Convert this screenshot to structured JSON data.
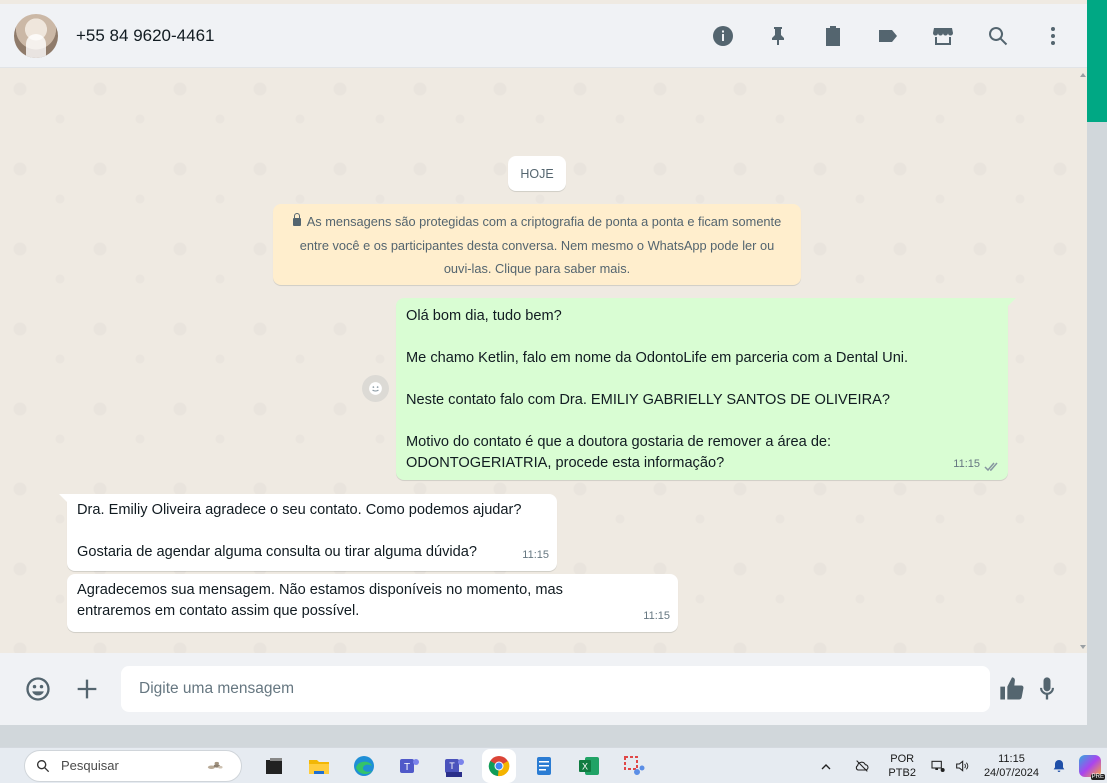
{
  "header": {
    "contact_name": "+55 84 9620-4461",
    "icons": [
      "info-icon",
      "pin-icon",
      "clipboard-icon",
      "label-icon",
      "store-icon",
      "search-icon",
      "more-vertical-icon"
    ]
  },
  "chat": {
    "date_chip": "HOJE",
    "encryption_notice": "As mensagens são protegidas com a criptografia de ponta a ponta e ficam somente entre você e os participantes desta conversa. Nem mesmo o WhatsApp pode ler ou ouvi-las. Clique para saber mais.",
    "messages": [
      {
        "direction": "outgoing",
        "text": "Olá bom dia, tudo bem?\n\nMe chamo Ketlin, falo em nome da OdontoLife em parceria com a Dental Uni.\n\nNeste contato falo com Dra. EMILIY GABRIELLY SANTOS DE OLIVEIRA?\n\nMotivo do contato é que a doutora gostaria de remover a área de:\nODONTOGERIATRIA, procede esta informação?",
        "time": "11:15",
        "status": "read"
      },
      {
        "direction": "incoming",
        "text": "Dra. Emiliy Oliveira agradece o seu contato. Como podemos ajudar?\n\nGostaria de agendar alguma consulta ou tirar alguma dúvida?",
        "time": "11:15"
      },
      {
        "direction": "incoming",
        "text": "Agradecemos sua mensagem. Não estamos disponíveis no momento, mas\nentraremos em contato assim que possível.",
        "time": "11:15"
      }
    ]
  },
  "footer": {
    "placeholder": "Digite uma mensagem"
  },
  "taskbar": {
    "search_label": "Pesquisar",
    "apps": [
      "task-view-icon",
      "file-explorer-icon",
      "edge-icon",
      "teams-icon",
      "teams-new-icon",
      "chrome-icon",
      "notepad-icon",
      "excel-icon",
      "snipping-tool-icon"
    ],
    "lang_line1": "POR",
    "lang_line2": "PTB2",
    "time": "11:15",
    "date": "24/07/2024"
  },
  "colors": {
    "accent": "#00a884",
    "outgoing_bubble": "#d9fdd3",
    "incoming_bubble": "#ffffff",
    "encryption_bg": "#ffeecd"
  }
}
